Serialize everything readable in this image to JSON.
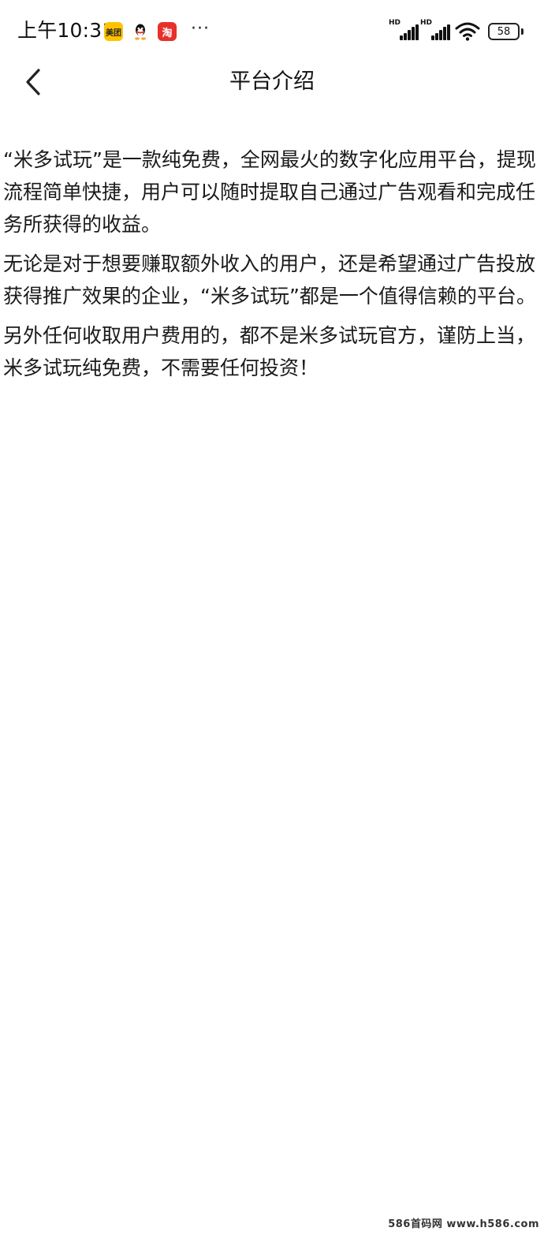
{
  "status_bar": {
    "time": "上午10:31",
    "notification_icons": [
      {
        "icon": "meituan-app-icon",
        "label": "美团"
      },
      {
        "icon": "qq-app-icon",
        "label": ""
      },
      {
        "icon": "taobao-app-icon",
        "label": "淘"
      }
    ],
    "more": "···",
    "signal_1_label": "HD",
    "signal_2_label": "HD",
    "battery_level": "58"
  },
  "header": {
    "title": "平台介绍",
    "back_icon": "chevron-left-icon"
  },
  "content": {
    "paragraphs": [
      "“米多试玩”是一款纯免费，全网最火的数字化应用平台，提现流程简单快捷，用户可以随时提取自己通过广告观看和完成任务所获得的收益。",
      "无论是对于想要赚取额外收入的用户，还是希望通过广告投放获得推广效果的企业，“米多试玩”都是一个值得信赖的平台。",
      "另外任何收取用户费用的，都不是米多试玩官方，谨防上当，米多试玩纯免费，不需要任何投资！"
    ]
  },
  "watermark": "586首码网 www.h586.com",
  "colors": {
    "background": "#ffffff",
    "text": "#1a1a1a",
    "meituan_yellow": "#ffc300",
    "taobao_red": "#e8302a"
  }
}
